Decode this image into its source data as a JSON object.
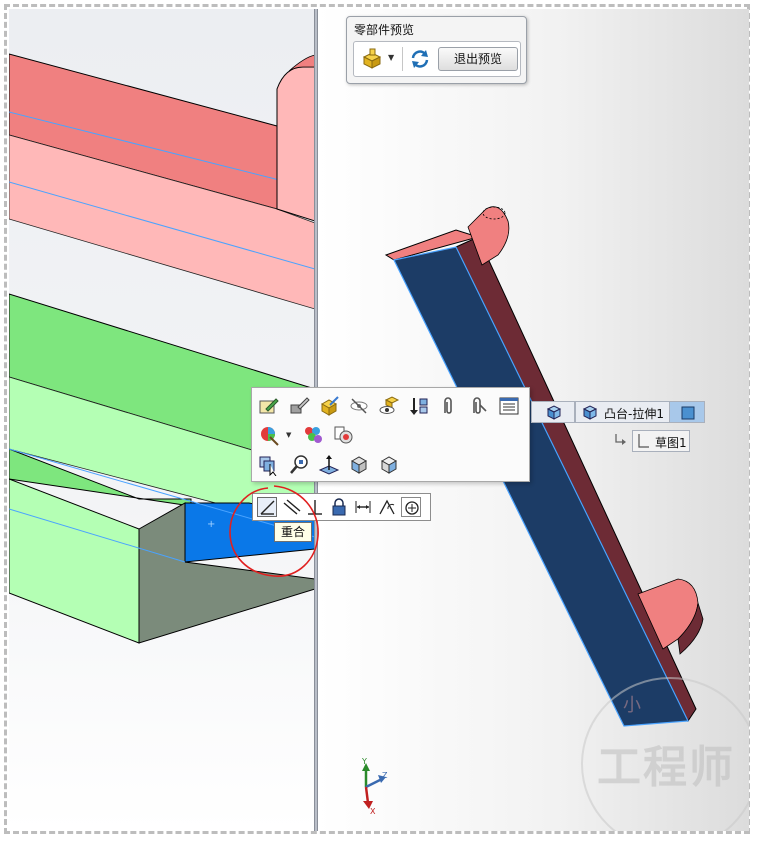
{
  "preview_panel": {
    "title": "零部件预览",
    "exit_label": "退出预览",
    "icons": [
      "part-icon",
      "dropdown-caret",
      "refresh-icon"
    ]
  },
  "context_toolbar": {
    "row1": [
      "edit-sketch-icon",
      "edit-feature-icon",
      "appearance-icon",
      "hide-icon",
      "show-icon",
      "rollback-icon",
      "paperclip-icon",
      "paperclip-alt-icon",
      "properties-icon"
    ],
    "row2": [
      "color-icon",
      "appearance-cubes-icon",
      "part-appearance-icon"
    ],
    "row3": [
      "select-other-icon",
      "zoom-to-selection-icon",
      "normal-to-icon",
      "view-orientation-icon",
      "view-cube-icon"
    ]
  },
  "relations_bar": {
    "icons": [
      "coincident-icon",
      "parallel-icon",
      "perpendicular-icon",
      "fix-icon",
      "equal-icon",
      "tangent-icon",
      "concentric-icon"
    ],
    "tooltip": "重合"
  },
  "breadcrumb": {
    "items": [
      "凸台-拉伸1"
    ],
    "sketch": "草图1"
  },
  "watermark": {
    "text": "工程师",
    "small": "小"
  },
  "triad": {
    "x": "X",
    "y": "Y",
    "z": "Z"
  },
  "colors": {
    "red_face": "#f08080",
    "red_light": "#ffb3b3",
    "green_face": "#7ee67e",
    "green_light": "#b3ffb3",
    "blue_face": "#1c3c66",
    "dark_red": "#6d2b35",
    "highlight": "#4aa3ff",
    "selected_blue": "#0a78e8"
  }
}
